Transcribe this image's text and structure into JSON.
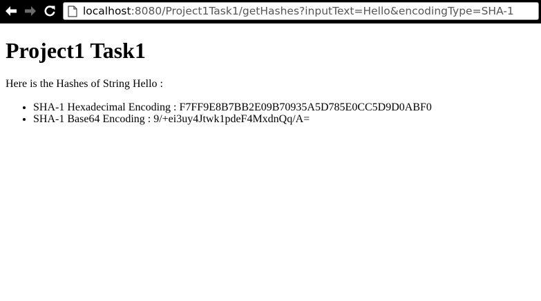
{
  "browser": {
    "back_icon": "back-arrow-icon",
    "forward_icon": "forward-arrow-icon",
    "reload_icon": "reload-icon",
    "page_icon": "page-icon",
    "url_host": "localhost",
    "url_rest": ":8080/Project1Task1/getHashes?inputText=Hello&encodingType=SHA-1"
  },
  "page": {
    "title": "Project1 Task1",
    "intro": "Here is the Hashes of String Hello :",
    "hashes": [
      "SHA-1 Hexadecimal Encoding : F7FF9E8B7BB2E09B70935A5D785E0CC5D9D0ABF0",
      "SHA-1 Base64 Encoding : 9/+ei3uy4Jtwk1pdeF4MxdnQq/A="
    ]
  },
  "colors": {
    "toolbar_bg": "#000000",
    "page_bg": "#ffffff",
    "url_host": "#000000",
    "url_rest": "#555555"
  }
}
